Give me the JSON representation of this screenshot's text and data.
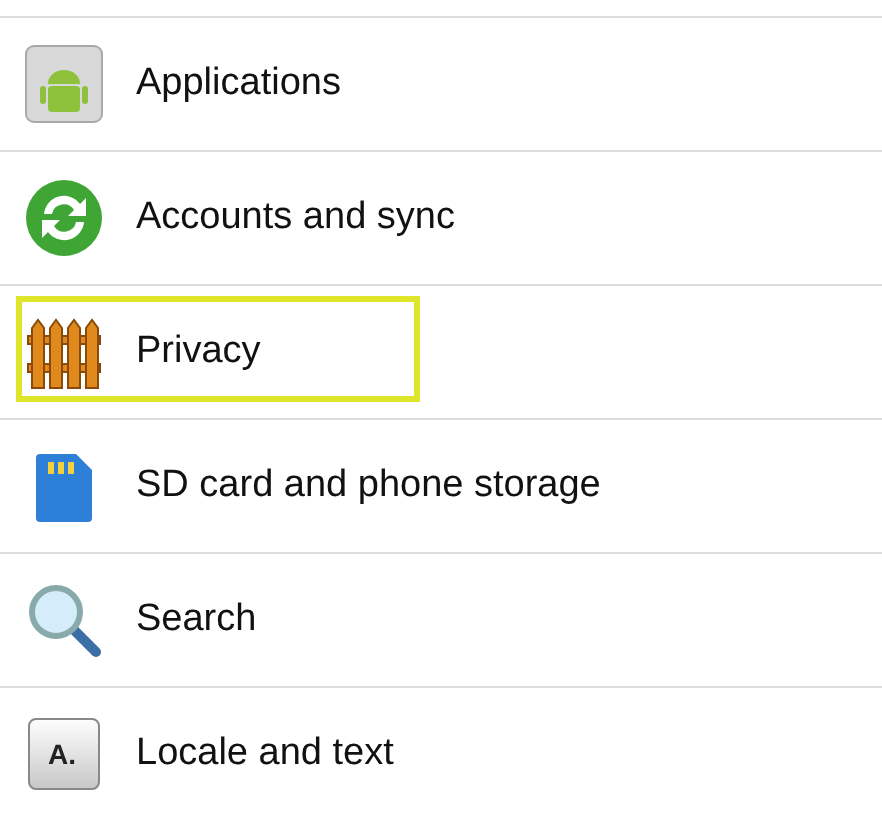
{
  "settings_items": [
    {
      "kind": "android",
      "label": "Applications",
      "highlighted": false
    },
    {
      "kind": "sync",
      "label": "Accounts and sync",
      "highlighted": false
    },
    {
      "kind": "fence",
      "label": "Privacy",
      "highlighted": true
    },
    {
      "kind": "sdcard",
      "label": "SD card and phone storage",
      "highlighted": false
    },
    {
      "kind": "search",
      "label": "Search",
      "highlighted": false
    },
    {
      "kind": "key",
      "label": "Locale and text",
      "highlighted": false,
      "icon_label": "A."
    }
  ]
}
